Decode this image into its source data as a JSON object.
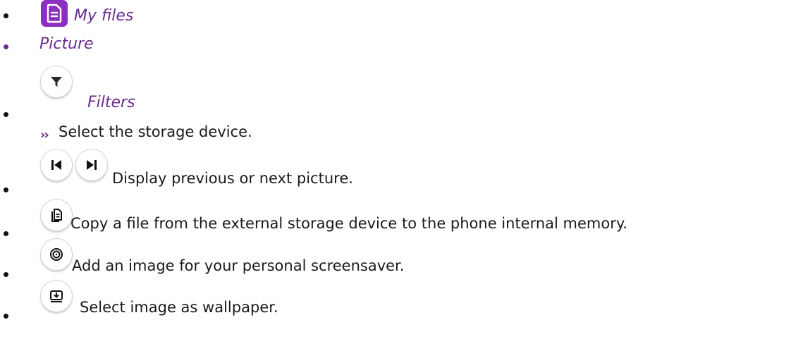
{
  "items": {
    "my_files": {
      "label": "My files",
      "icon": "document-icon"
    },
    "picture": {
      "label": "Picture"
    },
    "filters": {
      "label": "Filters",
      "icon": "filter-icon",
      "sub_prefix": "››",
      "sub_text": "Select the storage device."
    },
    "prev_next": {
      "text": "Display previous or next picture.",
      "icons": [
        "skip-previous-icon",
        "skip-next-icon"
      ]
    },
    "copy": {
      "text": "Copy a file from the external storage device to the phone internal memory.",
      "icon": "copy-file-icon"
    },
    "screensaver": {
      "text": "Add an image for your personal screensaver.",
      "icon": "spiral-icon"
    },
    "wallpaper": {
      "text": "Select image as wallpaper.",
      "icon": "wallpaper-download-icon"
    }
  },
  "colors": {
    "accent_purple": "#6b2d8f",
    "icon_purple": "#8a2fc2",
    "text": "#1a1a1a"
  }
}
